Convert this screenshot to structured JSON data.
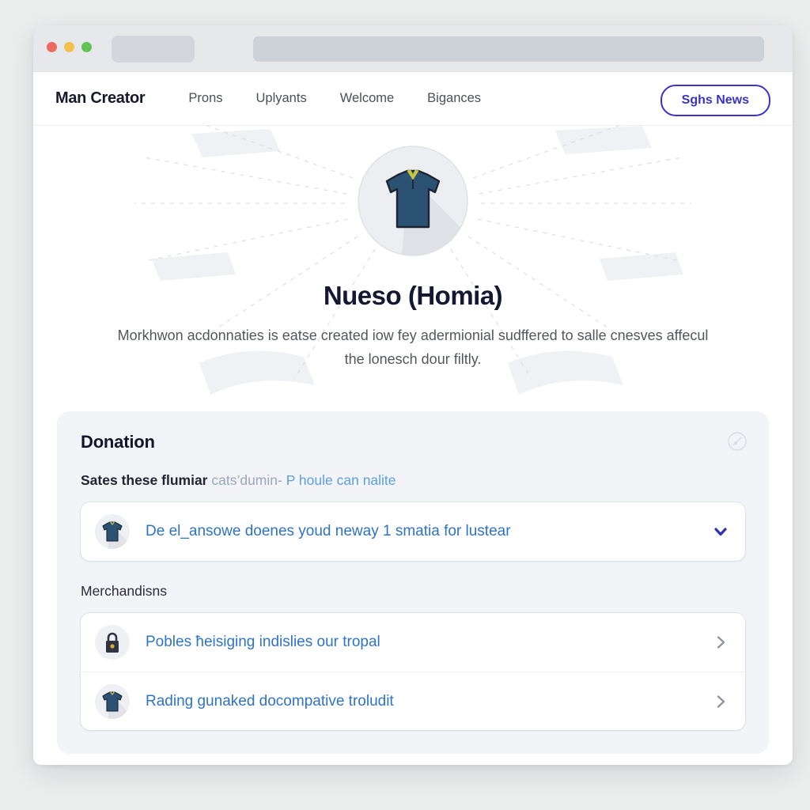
{
  "browser": {
    "traffic_lights": [
      "close",
      "minimize",
      "maximize"
    ],
    "tab_placeholder": "",
    "urlbar_placeholder": ""
  },
  "nav": {
    "brand": "Man Creator",
    "links": [
      {
        "label": "Prons"
      },
      {
        "label": "Uplyants"
      },
      {
        "label": "Welcome"
      },
      {
        "label": "Bigances"
      }
    ],
    "cta": {
      "label": "Sghs News",
      "color": "#3b32c8"
    }
  },
  "hero": {
    "icon": "tshirt-icon",
    "title": "Nueso (Homia)",
    "description": "Morkhwon acdonnaties is eatse created iow fey adermionial sudffered to salle cnesves affecul the lonesch dour filtly."
  },
  "card": {
    "title": "Donation",
    "corner_icon": "compass-icon",
    "subline": {
      "strong": "Sates these flumiar",
      "muted": "cats’dumin-",
      "link": "P houle can nalite"
    },
    "primary_rows": [
      {
        "avatar": "tshirt-icon",
        "label": "De el_ansowe doenes youd neway 1 smatia for lustear",
        "chevron": "chevron-down-icon",
        "chevron_color": "#2f32b4"
      }
    ],
    "section_heading": "Merchandisns",
    "merch_rows": [
      {
        "avatar": "lock-icon",
        "label": "Pobles ħeisiging indislies our tropal",
        "chevron": "chevron-right-icon",
        "chevron_color": "#8e949e"
      },
      {
        "avatar": "tshirt-icon",
        "label": "Rading gunaked docompative troludit",
        "chevron": "chevron-right-icon",
        "chevron_color": "#8e949e"
      }
    ]
  },
  "colors": {
    "accent_indigo": "#3b32c8",
    "link_blue": "#2f73c4",
    "card_bg": "#f3f4f8",
    "jersey_navy": "#2b5272",
    "jersey_collar": "#c8c84a"
  }
}
